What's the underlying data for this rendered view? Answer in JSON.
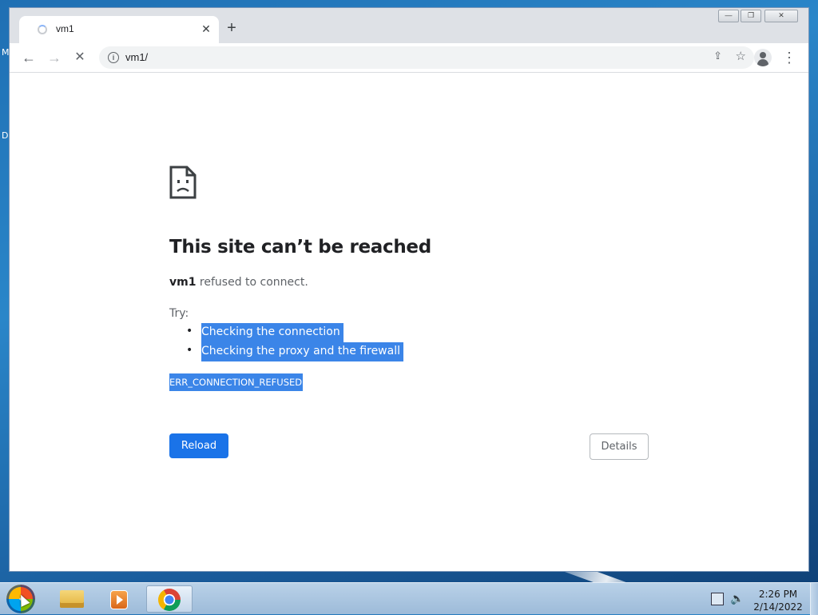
{
  "desktop": {
    "fragment_top": "M",
    "fragment_mid": "D"
  },
  "browser": {
    "tab": {
      "title": "vm1",
      "close_glyph": "✕"
    },
    "new_tab_glyph": "+",
    "window_controls": {
      "minimize": "—",
      "restore": "❐",
      "close": "✕"
    },
    "nav": {
      "back": "←",
      "forward": "→",
      "stop": "✕",
      "menu": "⋮"
    },
    "omnibox": {
      "info_glyph": "i",
      "url": "vm1/",
      "share_glyph": "⇪",
      "star_glyph": "☆"
    }
  },
  "error_page": {
    "title": "This site can’t be reached",
    "host": "vm1",
    "summary_suffix": " refused to connect.",
    "try_label": "Try:",
    "suggestions": [
      "Checking the connection",
      "Checking the proxy and the firewall"
    ],
    "error_code": "ERR_CONNECTION_REFUSED",
    "reload_label": "Reload",
    "details_label": "Details"
  },
  "taskbar": {
    "clock_time": "2:26 PM",
    "clock_date": "2/14/2022",
    "volume_glyph": "🔈"
  },
  "colors": {
    "selection": "#3b85e8",
    "primary_button": "#1a73e8",
    "tab_strip": "#dee1e6"
  }
}
